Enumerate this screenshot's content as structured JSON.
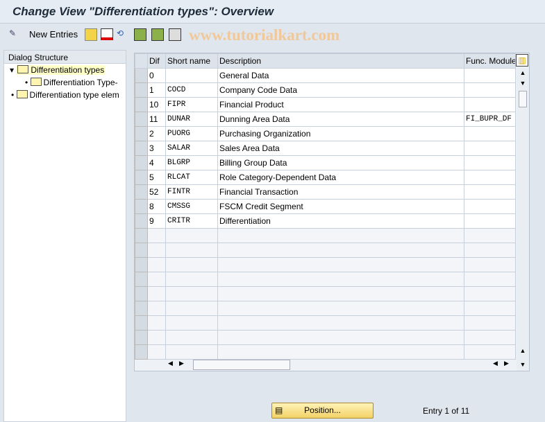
{
  "title": "Change View \"Differentiation types\": Overview",
  "toolbar": {
    "new_entries": "New Entries",
    "watermark": "www.tutorialkart.com"
  },
  "dialog": {
    "header": "Dialog Structure",
    "nodes": [
      "Differentiation types",
      "Differentiation Type-",
      "Differentiation type elem"
    ]
  },
  "table": {
    "headers": [
      "Dif",
      "Short name",
      "Description",
      "Func. Module"
    ],
    "rows": [
      [
        "0",
        "",
        "General Data",
        ""
      ],
      [
        "1",
        "COCD",
        "Company Code Data",
        ""
      ],
      [
        "10",
        "FIPR",
        "Financial Product",
        ""
      ],
      [
        "11",
        "DUNAR",
        "Dunning Area Data",
        "FI_BUPR_DF"
      ],
      [
        "2",
        "PUORG",
        "Purchasing Organization",
        ""
      ],
      [
        "3",
        "SALAR",
        "Sales Area Data",
        ""
      ],
      [
        "4",
        "BLGRP",
        "Billing Group Data",
        ""
      ],
      [
        "5",
        "RLCAT",
        "Role Category-Dependent Data",
        ""
      ],
      [
        "52",
        "FINTR",
        "Financial Transaction",
        ""
      ],
      [
        "8",
        "CMSSG",
        "FSCM Credit Segment",
        ""
      ],
      [
        "9",
        "CRITR",
        "Differentiation",
        ""
      ]
    ]
  },
  "footer": {
    "position": "Position...",
    "entry": "Entry 1 of 11"
  }
}
